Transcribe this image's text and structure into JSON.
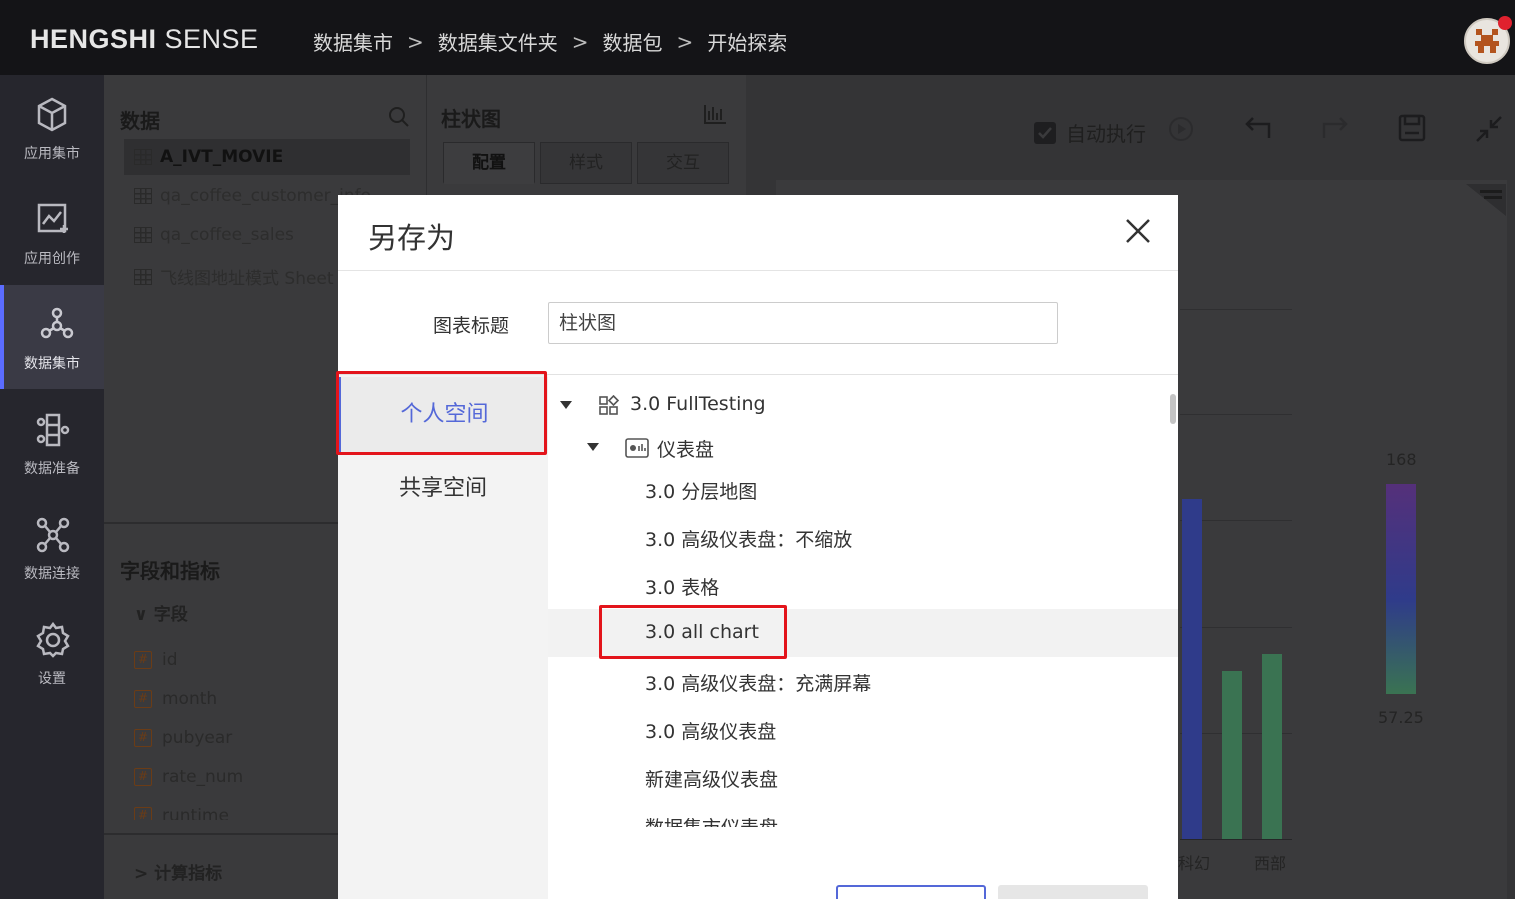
{
  "brand": {
    "bold": "HENGSHI",
    "light": " SENSE"
  },
  "breadcrumb": [
    "数据集市",
    "数据集文件夹",
    "数据包",
    "开始探索"
  ],
  "breadcrumb_sep": ">",
  "leftnav": [
    {
      "label": "应用集市",
      "icon": "cube-icon"
    },
    {
      "label": "应用创作",
      "icon": "chart-edit-icon"
    },
    {
      "label": "数据集市",
      "icon": "molecule-icon",
      "active": true
    },
    {
      "label": "数据准备",
      "icon": "data-prep-icon"
    },
    {
      "label": "数据连接",
      "icon": "network-icon"
    },
    {
      "label": "设置",
      "icon": "gear-icon"
    }
  ],
  "data_panel": {
    "title": "数据",
    "datasets": [
      "A_IVT_MOVIE",
      "qa_coffee_customer_info",
      "qa_coffee_sales",
      "飞线图地址模式 Sheet"
    ],
    "fields_title": "字段和指标",
    "fields_group": "字段",
    "fields": [
      "id",
      "month",
      "pubyear",
      "rate_num",
      "runtime"
    ],
    "metrics_group": "计算指标"
  },
  "config_panel": {
    "title": "柱状图",
    "tabs": [
      "配置",
      "样式",
      "交互"
    ]
  },
  "toolbar": {
    "auto_run_label": "自动执行",
    "auto_run_checked": true
  },
  "chart": {
    "legend_max": "168",
    "legend_min": "57.25",
    "x_labels": [
      "科幻",
      "西部"
    ]
  },
  "modal": {
    "title": "另存为",
    "field_label": "图表标题",
    "field_value": "柱状图",
    "spaces": [
      "个人空间",
      "共享空间"
    ],
    "tree": [
      {
        "label": "3.0 FullTesting",
        "level": 0,
        "expanded": true,
        "icon": "folder-grid-icon"
      },
      {
        "label": "仪表盘",
        "level": 1,
        "expanded": true,
        "icon": "dashboard-icon"
      },
      {
        "label": "3.0 分层地图",
        "level": 2
      },
      {
        "label": "3.0 高级仪表盘：不缩放",
        "level": 2
      },
      {
        "label": "3.0 表格",
        "level": 2
      },
      {
        "label": "3.0 all chart",
        "level": 2,
        "selected": true
      },
      {
        "label": "3.0 高级仪表盘：充满屏幕",
        "level": 2
      },
      {
        "label": "3.0 高级仪表盘",
        "level": 2
      },
      {
        "label": "新建高级仪表盘",
        "level": 2
      },
      {
        "label": "数据集市仪表盘",
        "level": 2
      }
    ]
  },
  "colors": {
    "accent": "#5468d8",
    "highlight_box": "#e3141b",
    "bar_blue": "#3f50b5",
    "bar_green": "#4c9a72"
  }
}
